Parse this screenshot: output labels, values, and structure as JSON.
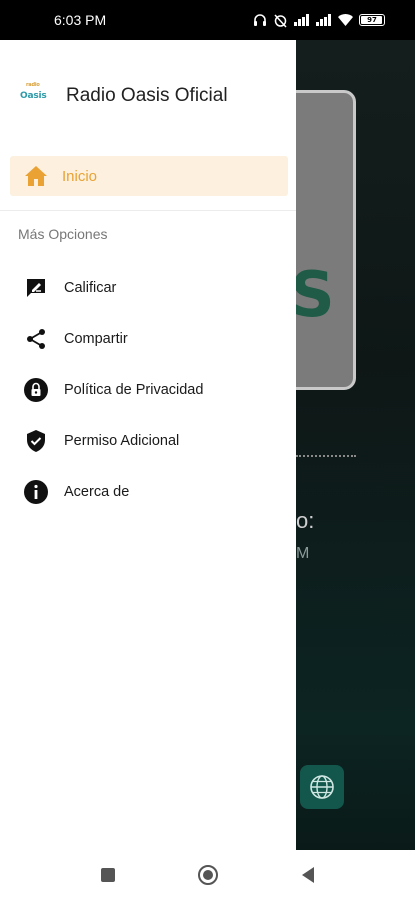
{
  "status": {
    "time": "6:03 PM",
    "battery": "97"
  },
  "drawer": {
    "brand_logo_text": "Oasis",
    "brand_logo_small": "radio",
    "title": "Radio Oasis Oficial",
    "active_item": {
      "label": "Inicio",
      "icon": "home-icon"
    },
    "section_label": "Más Opciones",
    "items": [
      {
        "label": "Calificar",
        "icon": "rate-icon"
      },
      {
        "label": "Compartir",
        "icon": "share-icon"
      },
      {
        "label": "Política de Privacidad",
        "icon": "lock-icon"
      },
      {
        "label": "Permiso Adicional",
        "icon": "shield-icon"
      },
      {
        "label": "Acerca de",
        "icon": "info-icon"
      }
    ]
  },
  "background": {
    "logo_fragment": "S",
    "text_1": "o:",
    "text_2": "M"
  },
  "colors": {
    "accent": "#e9a233",
    "active_bg": "#fdf0de",
    "background_dark": "#0e1716"
  }
}
